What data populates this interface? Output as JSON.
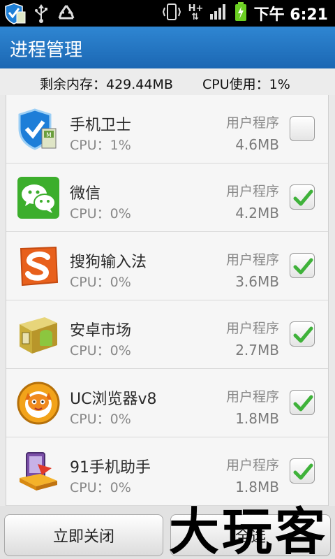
{
  "status_bar": {
    "time": "下午 6:21",
    "network": "H+",
    "left_icons": [
      "shield-app-icon",
      "usb-icon",
      "recycle-icon"
    ],
    "right_icons": [
      "vibrate-icon",
      "network-h-plus-icon",
      "signal-icon",
      "battery-charging-icon"
    ]
  },
  "header": {
    "title": "进程管理"
  },
  "info": {
    "memory": "剩余内存：429.44MB",
    "cpu": "CPU使用：1%"
  },
  "processes": [
    {
      "name": "手机卫士",
      "cpu": "CPU：1%",
      "type": "用户程序",
      "memory": "4.6MB",
      "checked": false,
      "icon": "shield-app-icon"
    },
    {
      "name": "微信",
      "cpu": "CPU：0%",
      "type": "用户程序",
      "memory": "4.2MB",
      "checked": true,
      "icon": "wechat-icon"
    },
    {
      "name": "搜狗输入法",
      "cpu": "CPU：0%",
      "type": "用户程序",
      "memory": "3.6MB",
      "checked": true,
      "icon": "sogou-icon"
    },
    {
      "name": "安卓市场",
      "cpu": "CPU：0%",
      "type": "用户程序",
      "memory": "2.7MB",
      "checked": true,
      "icon": "android-market-icon"
    },
    {
      "name": "UC浏览器v8",
      "cpu": "CPU：0%",
      "type": "用户程序",
      "memory": "1.8MB",
      "checked": true,
      "icon": "uc-browser-icon"
    },
    {
      "name": "91手机助手",
      "cpu": "CPU：0%",
      "type": "用户程序",
      "memory": "1.8MB",
      "checked": true,
      "icon": "91-assistant-icon"
    }
  ],
  "buttons": {
    "close": "立即关闭",
    "select_all": "全选"
  },
  "watermark": "大玩客",
  "colors": {
    "header": "#1f6fbd",
    "check": "#3fb23a"
  }
}
